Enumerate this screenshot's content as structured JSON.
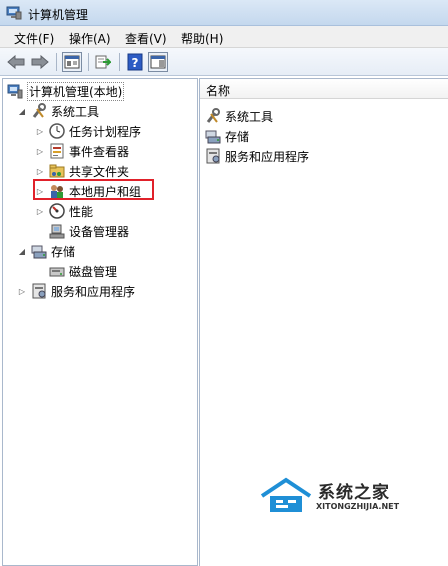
{
  "window": {
    "title": "计算机管理"
  },
  "menu": [
    "文件(F)",
    "操作(A)",
    "查看(V)",
    "帮助(H)"
  ],
  "toolbar": {
    "icons": [
      "back-arrow-icon",
      "forward-arrow-icon",
      "show-hide-tree-icon",
      "export-list-icon",
      "help-icon",
      "properties-icon"
    ]
  },
  "tree": {
    "root": "计算机管理(本地)",
    "system_tools": "系统工具",
    "task_scheduler": "任务计划程序",
    "event_viewer": "事件查看器",
    "shared_folders": "共享文件夹",
    "local_users": "本地用户和组",
    "performance": "性能",
    "device_manager": "设备管理器",
    "storage": "存储",
    "disk_management": "磁盘管理",
    "services_apps": "服务和应用程序"
  },
  "list": {
    "header": "名称",
    "items": [
      "系统工具",
      "存储",
      "服务和应用程序"
    ]
  },
  "watermark": {
    "title": "系统之家",
    "url": "XITONGZHIJIA.NET"
  },
  "colors": {
    "highlight": "#e0212a",
    "titlebar": "#c4d8ee"
  }
}
